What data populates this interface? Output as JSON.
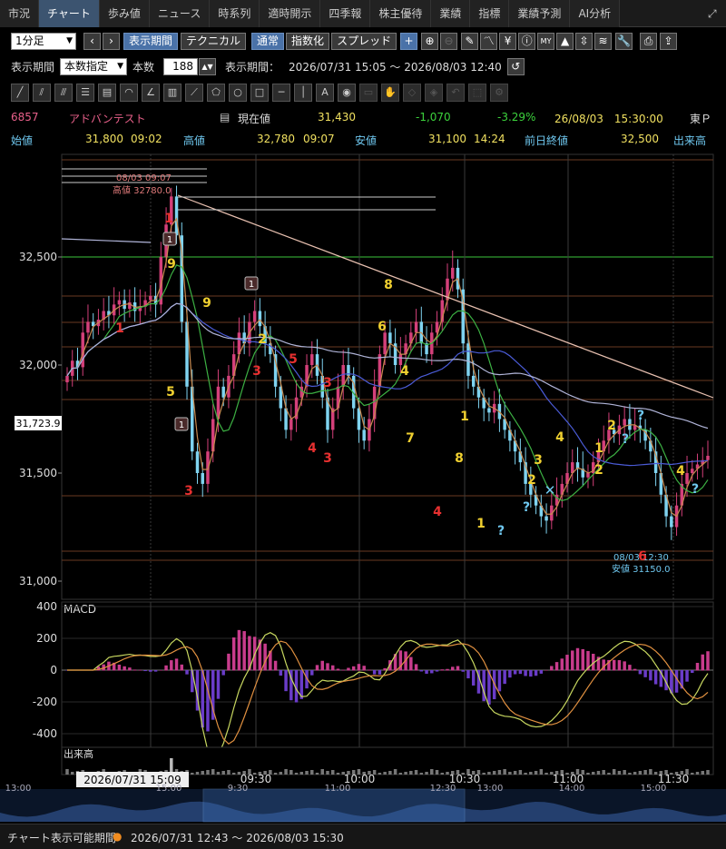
{
  "tabs": [
    "市況",
    "チャート",
    "歩み値",
    "ニュース",
    "時系列",
    "適時開示",
    "四季報",
    "株主優待",
    "業績",
    "指標",
    "業績予測",
    "AI分析"
  ],
  "active_tab": 1,
  "toolbar": {
    "interval": "1分足",
    "period_btn": "表示期間",
    "technical_btn": "テクニカル",
    "normal_btn": "通常",
    "index_btn": "指数化",
    "spread_btn": "スプレッド"
  },
  "period_bar": {
    "label": "表示期間",
    "mode": "本数指定",
    "count_label": "本数",
    "count": "188",
    "range_label": "表示期間：",
    "range": "2026/07/31 15:05 ～ 2026/08/03 12:40"
  },
  "quote": {
    "code": "6857",
    "name": "アドバンテスト",
    "current_label": "現在値",
    "current": "31,430",
    "change": "-1,070",
    "change_pct": "-3.29%",
    "datetime": "26/08/03　15:30:00",
    "market": "東Ｐ",
    "open_label": "始値",
    "open": "31,800",
    "open_time": "09:02",
    "high_label": "高値",
    "high": "32,780",
    "high_time": "09:07",
    "low_label": "安値",
    "low": "31,100",
    "low_time": "14:24",
    "prev_label": "前日終値",
    "prev": "32,500",
    "volume_label": "出来高"
  },
  "chart_data": {
    "type": "candlestick",
    "price_axis": {
      "labels": [
        "32,500",
        "32,000",
        "31,500",
        "31,000"
      ],
      "values": [
        32500,
        32000,
        31500,
        31000
      ],
      "ylim": [
        30900,
        32950
      ]
    },
    "current_price_tag": "31,723.9",
    "time_labels": [
      "09:30",
      "10:00",
      "10:30",
      "11:00",
      "11:30"
    ],
    "annotations": {
      "high_date": "08/03 09:07",
      "high_text": "高値 32780.0",
      "low_date": "08/03 12:30",
      "low_text": "安値 31150.0"
    },
    "macd": {
      "label": "MACD",
      "axis_labels": [
        "400",
        "200",
        "0",
        "-200",
        "-400"
      ],
      "axis_values": [
        400,
        200,
        0,
        -200,
        -400
      ]
    },
    "volume_label": "出来高",
    "cursor_date": "2026/07/31 15:09",
    "overview_labels": [
      "13:00",
      "15:00",
      "9:30",
      "11:00",
      "12:30",
      "13:00",
      "14:00",
      "15:00"
    ],
    "colors": {
      "up": "#d4407a",
      "down": "#7fd3f0",
      "ma_fast": "#c98b50",
      "ma_mid": "#4a5bd6",
      "ma_slow": "#b0b4d8",
      "trend": "#e8c0b0",
      "green_line": "#3cc43c",
      "macd": "#c8d860",
      "signal": "#e09040"
    }
  },
  "footer": {
    "label": "チャート表示可能期間",
    "range": "2026/07/31 12:43 ～ 2026/08/03 15:30"
  }
}
